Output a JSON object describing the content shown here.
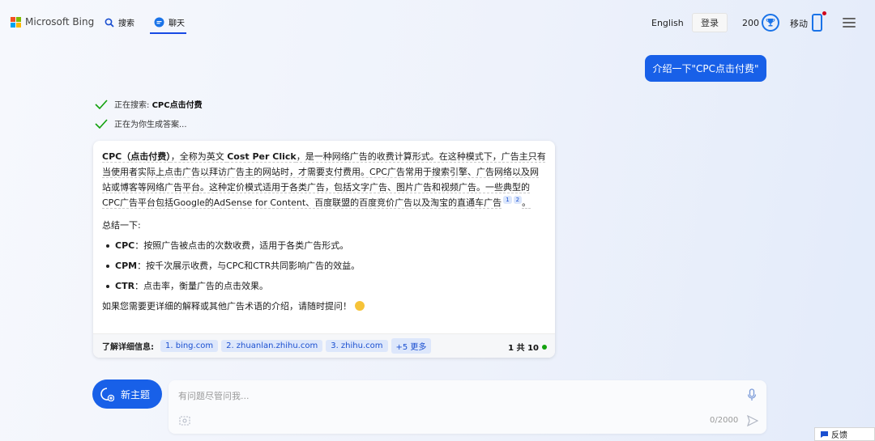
{
  "header": {
    "logo_text": "Microsoft Bing",
    "nav_search": "搜索",
    "nav_chat": "聊天",
    "language": "English",
    "login": "登录",
    "points": "200",
    "mobile": "移动"
  },
  "user_message": "介绍一下\"CPC点击付费\"",
  "progress": {
    "searching_prefix": "正在搜索: ",
    "searching_term": "CPC点击付费",
    "generating": "正在为你生成答案..."
  },
  "answer": {
    "intro_bold": "CPC（点击付费）",
    "intro_mid": "，全称为英文 ",
    "intro_term": "Cost Per Click",
    "intro_rest": "，是一种网络广告的收费计算形式。在这种模式下，广告主只有当使用者实际上点击广告以拜访广告主的网站时，才需要支付费用。CPC广告常用于搜索引擎、广告网络以及网站或博客等网络广告平台。这种定价模式适用于各类广告，包括文字广告、图片广告和视频广告。一些典型的CPC广告平台包括Google的AdSense for Content、百度联盟的百度竞价广告以及淘宝的直通车广告",
    "cite_1": "1",
    "cite_2": "2",
    "intro_end": "。",
    "summary_heading": "总结一下:",
    "bullets": [
      {
        "term": "CPC",
        "text": "：按照广告被点击的次数收费，适用于各类广告形式。"
      },
      {
        "term": "CPM",
        "text": "：按千次展示收费，与CPC和CTR共同影响广告的效益。"
      },
      {
        "term": "CTR",
        "text": "：点击率，衡量广告的点击效果。"
      }
    ],
    "closing": "如果您需要更详细的解释或其他广告术语的介绍，请随时提问！",
    "learn_more_label": "了解详细信息:",
    "sources": [
      "1. bing.com",
      "2. zhuanlan.zhihu.com",
      "3. zhihu.com",
      "+5 更多"
    ],
    "turn_count": "1 共 10"
  },
  "composer": {
    "new_topic": "新主题",
    "placeholder": "有问题尽管问我...",
    "char_count": "0/2000"
  },
  "feedback": "反馈",
  "colors": {
    "accent": "#1860e8",
    "success": "#13a10e",
    "chip_bg": "#dde7fb"
  }
}
